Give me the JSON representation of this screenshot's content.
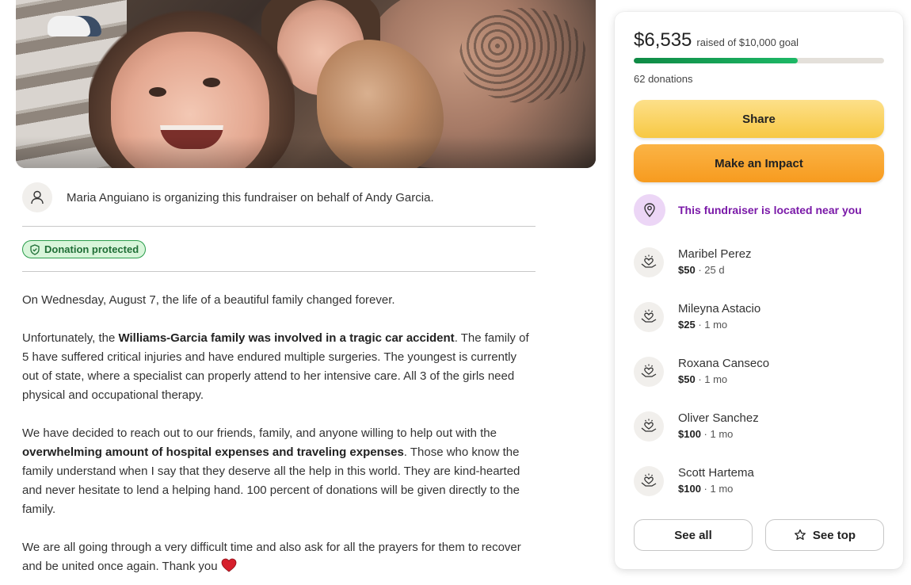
{
  "organizer": {
    "text": "Maria Anguiano is organizing this fundraiser on behalf of Andy Garcia."
  },
  "badge": {
    "label": "Donation protected"
  },
  "story": {
    "p1": "On Wednesday, August 7, the life of a beautiful family changed forever.",
    "p2_a": "Unfortunately, the ",
    "p2_b": "Williams-Garcia family was involved in a tragic car accident",
    "p2_c": ". The family of 5 have suffered critical injuries and have endured multiple surgeries. The youngest is currently out of state, where a specialist can properly attend to her intensive care. All 3 of the girls need physical and occupational therapy.",
    "p3_a": "We have decided to reach out to our friends, family, and anyone willing to help out with the ",
    "p3_b": "overwhelming amount of hospital expenses and traveling expenses",
    "p3_c": ". Those who know the family understand when I say that they deserve all the help in this world. They are kind-hearted and never hesitate to lend a helping hand. 100 percent of donations will be given directly to the family.",
    "p4": "We are all going through a very difficult time and also ask for all the prayers for them to recover and be united once again. Thank you"
  },
  "sidebar": {
    "raised": "$6,535",
    "goal_text": "raised of $10,000 goal",
    "progress_fraction": 0.6535,
    "donations_count": "62 donations",
    "share_label": "Share",
    "impact_label": "Make an Impact",
    "location_text": "This fundraiser is located near you",
    "donors": [
      {
        "name": "Maribel Perez",
        "amount": "$50",
        "time": " · 25 d"
      },
      {
        "name": "Mileyna Astacio",
        "amount": "$25",
        "time": " · 1 mo"
      },
      {
        "name": "Roxana Canseco",
        "amount": "$50",
        "time": " · 1 mo"
      },
      {
        "name": "Oliver Sanchez",
        "amount": "$100",
        "time": " · 1 mo"
      },
      {
        "name": "Scott Hartema",
        "amount": "$100",
        "time": " · 1 mo"
      }
    ],
    "see_all_label": "See all",
    "see_top_label": "See top"
  },
  "colors": {
    "progress": "#1db866",
    "share_button": "#f7c843",
    "impact_button": "#f79b1f",
    "location_accent": "#7a19a8",
    "badge_green": "#2a9d4b"
  }
}
